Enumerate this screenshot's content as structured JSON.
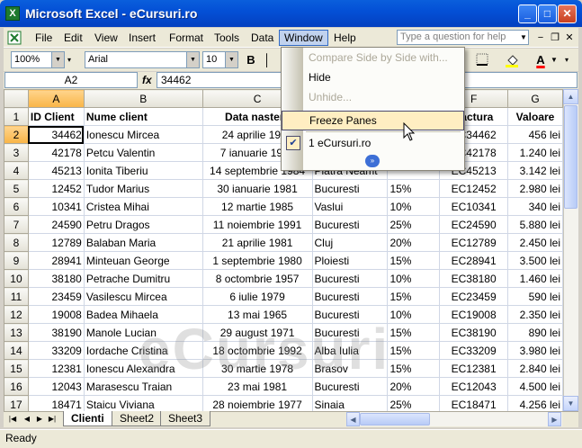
{
  "window": {
    "title": "Microsoft Excel - eCursuri.ro",
    "app_icon": "X",
    "minimize": "_",
    "maximize": "□",
    "close": "✕"
  },
  "menubar": {
    "items": [
      "File",
      "Edit",
      "View",
      "Insert",
      "Format",
      "Tools",
      "Data",
      "Window",
      "Help"
    ],
    "active": "Window",
    "help_placeholder": "Type a question for help",
    "mdi_minimize": "−",
    "mdi_restore": "❐",
    "mdi_close": "✕"
  },
  "toolbar": {
    "zoom": "100%",
    "font": "Arial",
    "size": "10",
    "bold": "B",
    "font_color": "#ff0000",
    "fill_color": "#ffff00"
  },
  "formula_bar": {
    "name_box": "A2",
    "fx": "fx",
    "value": "34462"
  },
  "columns": [
    "A",
    "B",
    "C",
    "D",
    "E",
    "F",
    "G"
  ],
  "selected_column": "A",
  "selected_row": "2",
  "rows": [
    [
      "1",
      "ID Client",
      "Nume client",
      "Data nasterii",
      "",
      "",
      "Factura",
      "Valoare"
    ],
    [
      "2",
      "34462",
      "Ionescu Mircea",
      "24 aprilie 1975",
      "",
      "",
      "EC34462",
      "456 lei"
    ],
    [
      "3",
      "42178",
      "Petcu Valentin",
      "7 ianuarie 1980",
      "",
      "",
      "EC42178",
      "1.240 lei"
    ],
    [
      "4",
      "45213",
      "Ionita Tiberiu",
      "14 septembrie 1984",
      "Piatra Neamt",
      "",
      "EC45213",
      "3.142 lei"
    ],
    [
      "5",
      "12452",
      "Tudor Marius",
      "30 ianuarie 1981",
      "Bucuresti",
      "15%",
      "EC12452",
      "2.980 lei"
    ],
    [
      "6",
      "10341",
      "Cristea Mihai",
      "12 martie 1985",
      "Vaslui",
      "10%",
      "EC10341",
      "340 lei"
    ],
    [
      "7",
      "24590",
      "Petru Dragos",
      "11 noiembrie 1991",
      "Bucuresti",
      "25%",
      "EC24590",
      "5.880 lei"
    ],
    [
      "8",
      "12789",
      "Balaban Maria",
      "21 aprilie 1981",
      "Cluj",
      "20%",
      "EC12789",
      "2.450 lei"
    ],
    [
      "9",
      "28941",
      "Minteuan George",
      "1 septembrie 1980",
      "Ploiesti",
      "15%",
      "EC28941",
      "3.500 lei"
    ],
    [
      "10",
      "38180",
      "Petrache Dumitru",
      "8 octombrie 1957",
      "Bucuresti",
      "10%",
      "EC38180",
      "1.460 lei"
    ],
    [
      "11",
      "23459",
      "Vasilescu Mircea",
      "6 iulie 1979",
      "Bucuresti",
      "15%",
      "EC23459",
      "590 lei"
    ],
    [
      "12",
      "19008",
      "Badea Mihaela",
      "13 mai 1965",
      "Bucuresti",
      "10%",
      "EC19008",
      "2.350 lei"
    ],
    [
      "13",
      "38190",
      "Manole Lucian",
      "29 august 1971",
      "Bucuresti",
      "15%",
      "EC38190",
      "890 lei"
    ],
    [
      "14",
      "33209",
      "Iordache Cristina",
      "18 octombrie 1992",
      "Alba Iulia",
      "15%",
      "EC33209",
      "3.980 lei"
    ],
    [
      "15",
      "12381",
      "Ionescu Alexandra",
      "30 martie 1978",
      "Brasov",
      "15%",
      "EC12381",
      "2.840 lei"
    ],
    [
      "16",
      "12043",
      "Marasescu Traian",
      "23 mai 1981",
      "Bucuresti",
      "20%",
      "EC12043",
      "4.500 lei"
    ],
    [
      "17",
      "18471",
      "Staicu Viviana",
      "28 noiembrie 1977",
      "Sinaia",
      "25%",
      "EC18471",
      "4.256 lei"
    ]
  ],
  "watermark": "eCursuri",
  "sheet_tabs": [
    "Clienti",
    "Sheet2",
    "Sheet3"
  ],
  "active_tab": "Clienti",
  "status": "Ready",
  "window_menu": {
    "items": [
      {
        "label": "Compare Side by Side with...",
        "enabled": false
      },
      {
        "label": "Hide",
        "enabled": true
      },
      {
        "label": "Unhide...",
        "enabled": false
      },
      {
        "label": "Freeze Panes",
        "enabled": true,
        "highlighted": true
      },
      {
        "label": "1 eCursuri.ro",
        "enabled": true,
        "checked": true
      }
    ],
    "check_mark": "✔",
    "expand": "»"
  }
}
